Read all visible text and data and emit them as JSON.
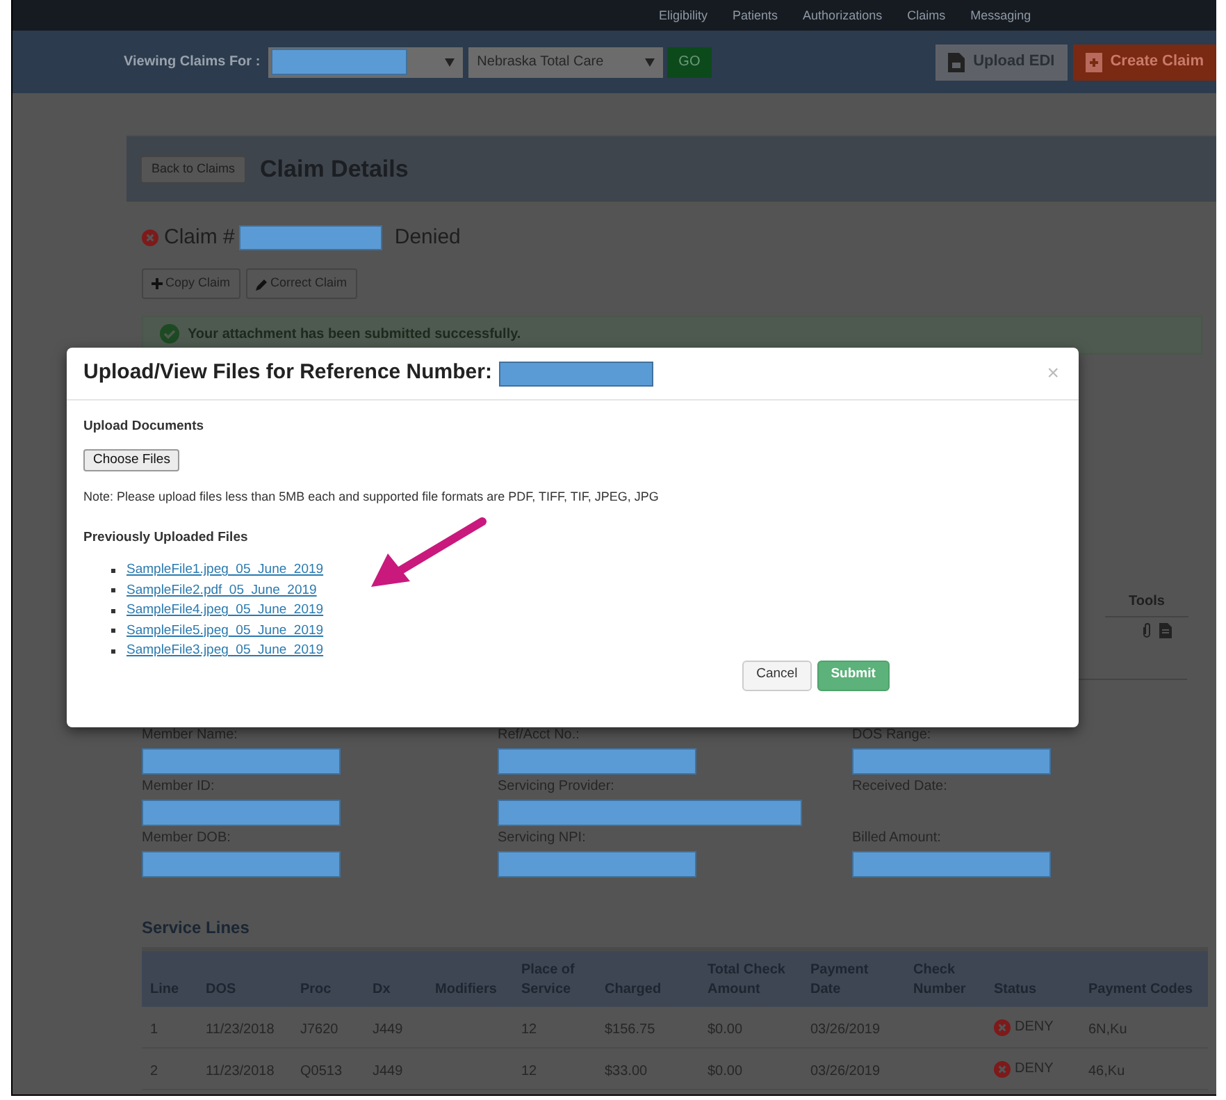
{
  "nav": {
    "items": [
      "Eligibility",
      "Patients",
      "Authorizations",
      "Claims",
      "Messaging"
    ]
  },
  "toolbar": {
    "viewing_label": "Viewing Claims For :",
    "provider_redacted": true,
    "plan_select": "Nebraska Total Care",
    "go_button": "GO",
    "upload_button": "Upload EDI",
    "create_button": "Create Claim"
  },
  "page": {
    "back_button": "Back to Claims",
    "title": "Claim Details",
    "claim_prefix": "Claim #",
    "claim_redacted": true,
    "claim_status": "Denied",
    "actions": [
      {
        "kind": "plus",
        "label": "Copy Claim"
      },
      {
        "kind": "pencil",
        "label": "Correct Claim"
      }
    ],
    "alert": "Your attachment has been submitted successfully.",
    "tools_header": "Tools"
  },
  "member_fields": [
    [
      {
        "label": "Member Name:",
        "redacted": true
      },
      {
        "label": "Member ID:",
        "redacted": true
      },
      {
        "label": "Member DOB:",
        "redacted": true
      }
    ],
    [
      {
        "label": "Ref/Acct No.:",
        "redacted": true
      },
      {
        "label": "Servicing Provider:",
        "redacted": true
      },
      {
        "label": "Servicing NPI:",
        "redacted": true
      }
    ],
    [
      {
        "label": "DOS Range:",
        "redacted": true
      },
      {
        "label": "Received Date:",
        "redacted": false
      },
      {
        "label": "Billed Amount:",
        "redacted": true
      }
    ]
  ],
  "service_lines": {
    "title": "Service Lines",
    "columns": [
      "Line",
      "DOS",
      "Proc",
      "Dx",
      "Modifiers",
      "Place of Service",
      "Charged",
      "Total Check Amount",
      "Payment Date",
      "Check Number",
      "Status",
      "Payment Codes"
    ],
    "rows": [
      {
        "cells": [
          "1",
          "11/23/2018",
          "J7620",
          "J449",
          "",
          "12",
          "$156.75",
          "$0.00",
          "03/26/2019",
          ""
        ],
        "status": "DENY",
        "codes": "6N,Ku"
      },
      {
        "cells": [
          "2",
          "11/23/2018",
          "Q0513",
          "J449",
          "",
          "12",
          "$33.00",
          "$0.00",
          "03/26/2019",
          ""
        ],
        "status": "DENY",
        "codes": "46,Ku"
      }
    ]
  },
  "modal": {
    "title": "Upload/View Files for Reference Number:",
    "reference_redacted": true,
    "close": "×",
    "upload_heading": "Upload Documents",
    "choose_button": "Choose Files",
    "note": "Note: Please upload files less than 5MB each and supported file formats are PDF, TIFF, TIF, JPEG, JPG",
    "previous_heading": "Previously Uploaded Files",
    "files": [
      "SampleFile1.jpeg_05_June_2019",
      "SampleFile2.pdf_05_June_2019",
      "SampleFile4.jpeg_05_June_2019",
      "SampleFile5.jpeg_05_June_2019",
      "SampleFile3.jpeg_05_June_2019"
    ],
    "cancel_button": "Cancel",
    "submit_button": "Submit"
  }
}
